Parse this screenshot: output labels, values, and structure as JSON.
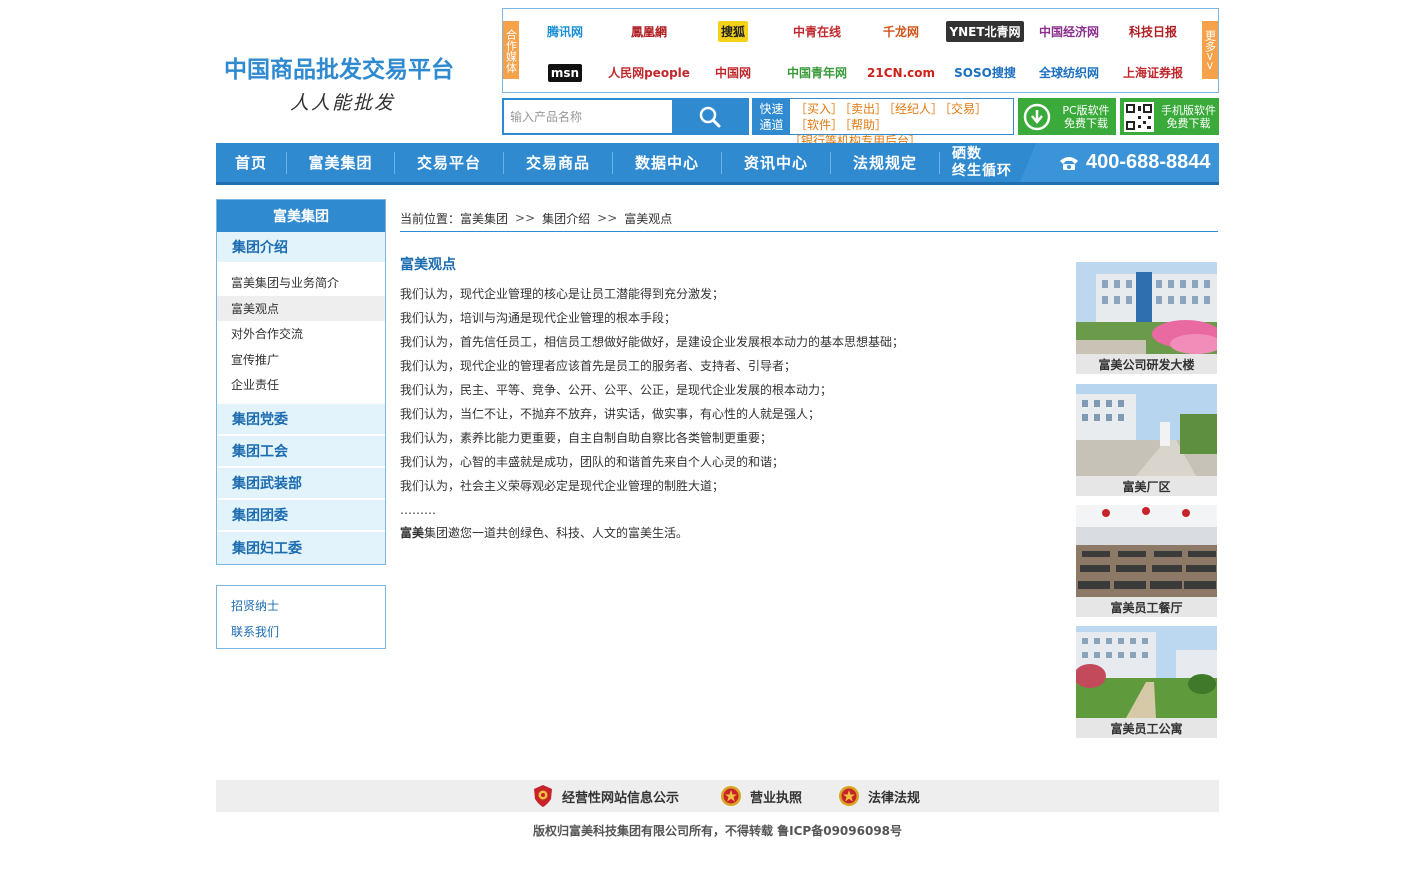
{
  "site": {
    "logo_title": "中国商品批发交易平台",
    "logo_subtitle": "人人能批发"
  },
  "media": {
    "left_label": "合作媒体",
    "more_label": "更多>>",
    "logos": [
      {
        "name": "腾讯网",
        "color": "#1a8fd8"
      },
      {
        "name": "鳳凰網",
        "color": "#b01d22"
      },
      {
        "name": "搜狐",
        "color": "#222222",
        "bg": "#f5d21a"
      },
      {
        "name": "中青在线",
        "color": "#c0282d"
      },
      {
        "name": "千龙网",
        "color": "#d0541a"
      },
      {
        "name": "YNET北青网",
        "color": "#ffffff",
        "bg": "#333333"
      },
      {
        "name": "中国经济网",
        "color": "#8a2f8e"
      },
      {
        "name": "科技日报",
        "color": "#b01d22"
      },
      {
        "name": "msn",
        "color": "#ffffff",
        "bg": "#111111"
      },
      {
        "name": "人民网people",
        "color": "#c0282d"
      },
      {
        "name": "中国网",
        "color": "#c0282d"
      },
      {
        "name": "中国青年网",
        "color": "#3a9a3a"
      },
      {
        "name": "21CN.com",
        "color": "#d0201a"
      },
      {
        "name": "SOSO搜搜",
        "color": "#1a6fc0"
      },
      {
        "name": "全球纺织网",
        "color": "#1a6fc0"
      },
      {
        "name": "上海证券报",
        "color": "#c0282d"
      }
    ]
  },
  "search": {
    "placeholder": "输入产品名称",
    "icon": "search-icon"
  },
  "quick": {
    "label_line1": "快速",
    "label_line2": "通道",
    "links_row1": [
      "［买入］",
      "［卖出］",
      "［经纪人］",
      "［交易］"
    ],
    "links_row2": [
      "［软件］",
      "［帮助］",
      "［银行等机构专用后台］"
    ]
  },
  "downloads": {
    "pc_line1": "PC版软件",
    "pc_line2": "免费下载",
    "mobile_line1": "手机版软件",
    "mobile_line2": "免费下载"
  },
  "nav": {
    "items": [
      "首页",
      "富美集团",
      "交易平台",
      "交易商品",
      "数据中心",
      "资讯中心",
      "法规规定"
    ],
    "last_line1": "硒数",
    "last_line2": "终生循环",
    "hotline": "400-688-8844"
  },
  "sidebar": {
    "header": "富美集团",
    "group1_title": "集团介绍",
    "group1_items": [
      "富美集团与业务简介",
      "富美观点",
      "对外合作交流",
      "宣传推广",
      "企业责任"
    ],
    "cats": [
      "集团党委",
      "集团工会",
      "集团武装部",
      "集团团委",
      "集团妇工委"
    ],
    "extra": [
      "招贤纳士",
      "联系我们"
    ]
  },
  "breadcrumb": {
    "prefix": "当前位置：",
    "items": [
      "富美集团",
      "集团介绍",
      "富美观点"
    ],
    "sep": ">>"
  },
  "content": {
    "title": "富美观点",
    "lines": [
      "我们认为，现代企业管理的核心是让员工潜能得到充分激发；",
      "我们认为，培训与沟通是现代企业管理的根本手段；",
      "我们认为，首先信任员工，相信员工想做好能做好，是建设企业发展根本动力的基本思想基础；",
      "我们认为，现代企业的管理者应该首先是员工的服务者、支持者、引导者；",
      "我们认为，民主、平等、竞争、公开、公平、公正，是现代企业发展的根本动力；",
      "我们认为，当仁不让，不抛弃不放弃，讲实话，做实事，有心性的人就是强人；",
      "我们认为，素养比能力更重要，自主自制自助自察比各类管制更重要；",
      "我们认为，心智的丰盛就是成功，团队的和谐首先来自个人心灵的和谐；",
      "我们认为，社会主义荣辱观必定是现代企业管理的制胜大道；",
      "………"
    ],
    "closing_bold": "富美",
    "closing_rest": "集团邀您一道共创绿色、科技、人文的富美生活。"
  },
  "photos": [
    {
      "caption": "富美公司研发大楼"
    },
    {
      "caption": "富美厂区"
    },
    {
      "caption": "富美员工餐厅"
    },
    {
      "caption": "富美员工公寓"
    }
  ],
  "footer": {
    "links": [
      "经营性网站信息公示",
      "营业执照",
      "法律法规"
    ],
    "copyright": "版权归富美科技集团有限公司所有，不得转载 鲁ICP备09096098号"
  },
  "colors": {
    "brand_blue": "#2f8ad0",
    "accent_orange": "#f5a24b",
    "download_green": "#3aaa3a"
  }
}
